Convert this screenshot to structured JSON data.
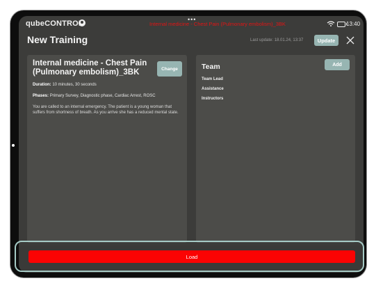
{
  "status_bar": {
    "app_name": "qubeCONTROL",
    "case_name": "Internal medicine - Chest Pain (Pulmonary embolism)_3BK",
    "time": "13:40",
    "case_color": "#e31414"
  },
  "header": {
    "title": "New Training",
    "last_update": "Last update: 18.01.24, 13:37",
    "update_label": "Update",
    "accent_color": "#97b5b2"
  },
  "training": {
    "title": "Internal medicine - Chest Pain (Pulmonary embolism)_3BK",
    "change_label": "Change",
    "duration_label": "Duration:",
    "duration_value": "10 minutes, 30 seconds",
    "phases_label": "Phases:",
    "phases_value": "Primary Survey, Diagnostic phase, Cardiac Arrest, ROSC",
    "description": "You are called to an internal emergency. The patient is a young woman that suffers from shortness of breath. As you arrive she has a reduced mental state."
  },
  "team": {
    "title": "Team",
    "add_label": "Add",
    "roles": [
      "Team Lead",
      "Assistance",
      "Instructors"
    ]
  },
  "footer": {
    "load_label": "Load",
    "load_color": "#fb0303"
  }
}
